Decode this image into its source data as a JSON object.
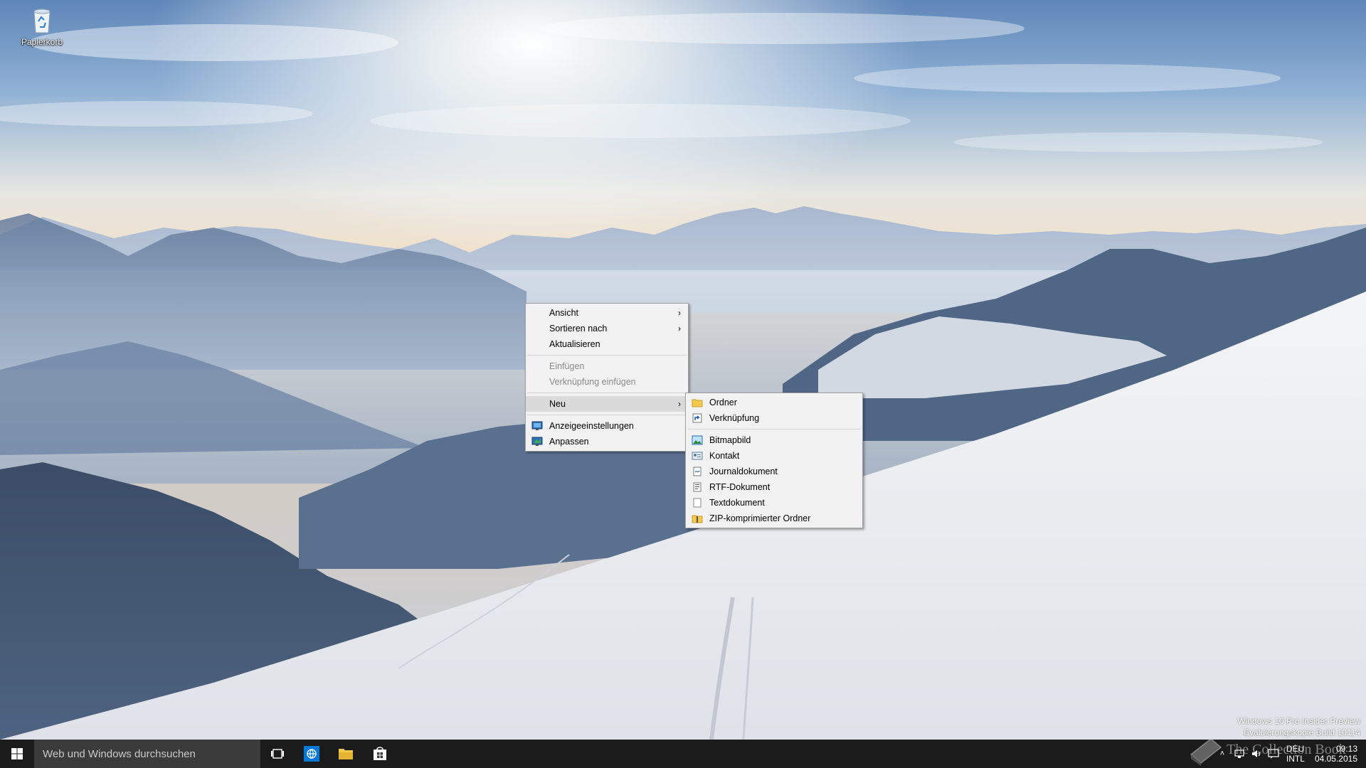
{
  "desktop": {
    "icons": [
      {
        "label": "Papierkorb",
        "icon": "recycle-bin-icon"
      }
    ]
  },
  "context_menu": {
    "groups": [
      [
        {
          "label": "Ansicht",
          "submenu": true
        },
        {
          "label": "Sortieren nach",
          "submenu": true
        },
        {
          "label": "Aktualisieren"
        }
      ],
      [
        {
          "label": "Einfügen",
          "disabled": true
        },
        {
          "label": "Verknüpfung einfügen",
          "disabled": true
        }
      ],
      [
        {
          "label": "Neu",
          "submenu": true,
          "highlighted": true
        }
      ],
      [
        {
          "label": "Anzeigeeinstellungen",
          "icon": "display-settings-icon"
        },
        {
          "label": "Anpassen",
          "icon": "personalize-icon"
        }
      ]
    ]
  },
  "submenu_new": {
    "items": [
      {
        "label": "Ordner",
        "icon": "folder-icon"
      },
      {
        "label": "Verknüpfung",
        "icon": "shortcut-icon"
      },
      {
        "label": "Bitmapbild",
        "icon": "bitmap-icon"
      },
      {
        "label": "Kontakt",
        "icon": "contact-icon"
      },
      {
        "label": "Journaldokument",
        "icon": "journal-icon"
      },
      {
        "label": "RTF-Dokument",
        "icon": "rtf-icon"
      },
      {
        "label": "Textdokument",
        "icon": "text-document-icon"
      },
      {
        "label": "ZIP-komprimierter Ordner",
        "icon": "zip-folder-icon"
      }
    ]
  },
  "watermark": {
    "line1": "Windows 10 Pro Insider Preview",
    "line2": "Evaluierungskopie Build 10114",
    "overlay": "The Collection Book"
  },
  "taskbar": {
    "search_placeholder": "Web und Windows durchsuchen",
    "language": "DEU",
    "keyboard": "INTL",
    "time": "09:13",
    "date": "04.05.2015"
  },
  "colors": {
    "taskbar_bg": "#1b1b1b",
    "search_bg": "#3b3b3b",
    "menu_bg": "#f2f2f2",
    "menu_highlight": "#dadada",
    "accent": "#0078d7"
  }
}
